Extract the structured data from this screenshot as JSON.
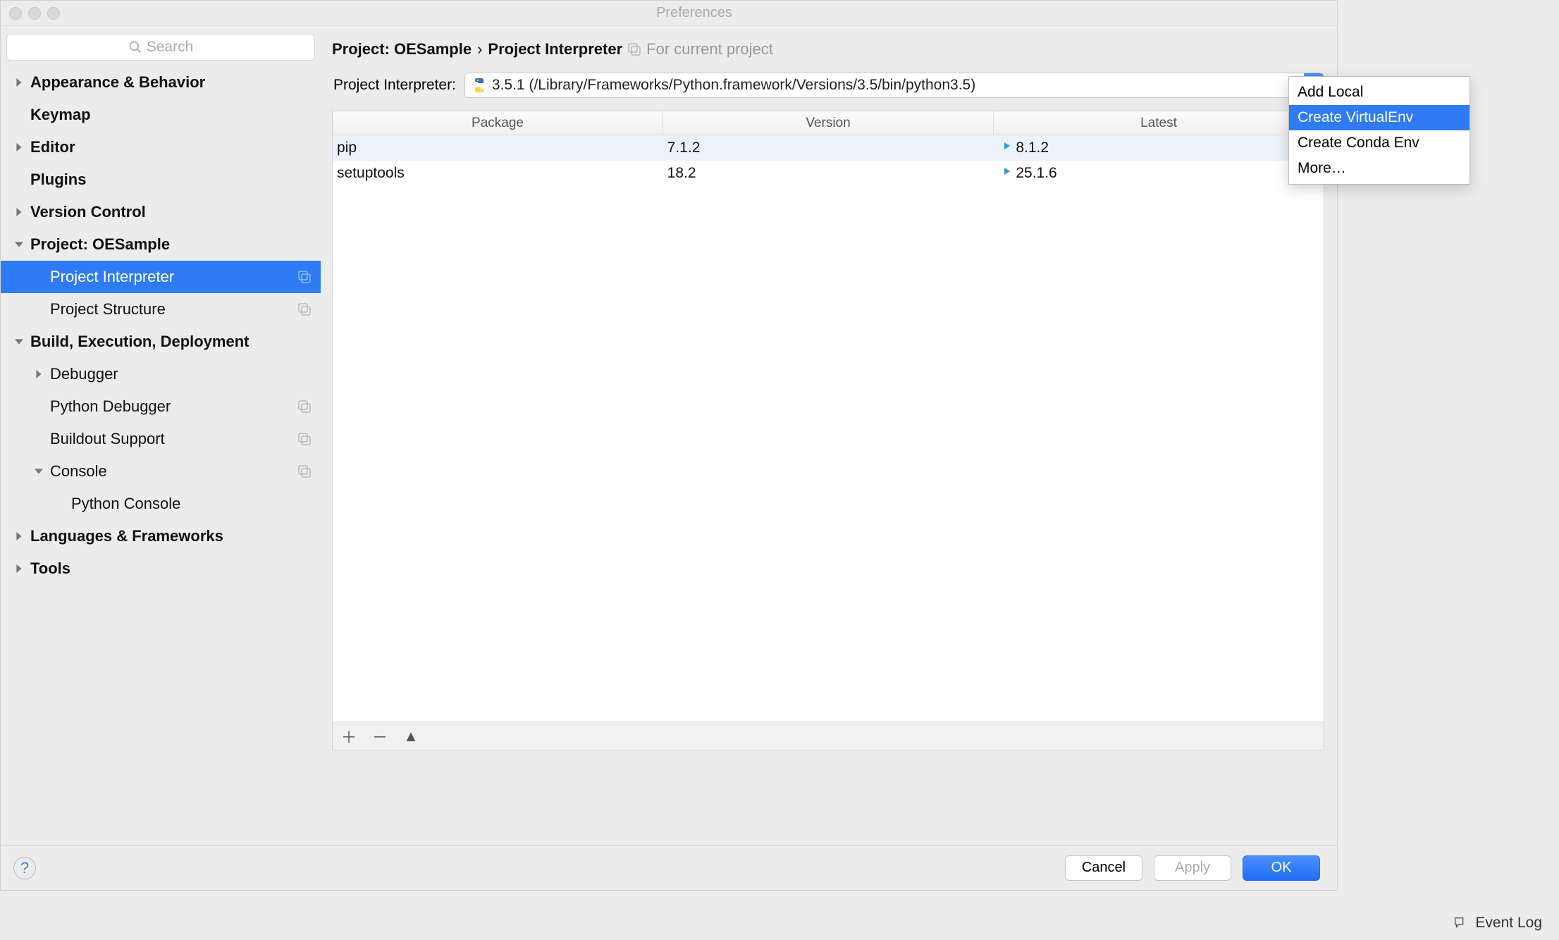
{
  "window": {
    "title": "Preferences"
  },
  "sidebar": {
    "search_placeholder": "Search",
    "items": [
      {
        "label": "Appearance & Behavior",
        "bold": true,
        "arrow": "right",
        "indent": 0
      },
      {
        "label": "Keymap",
        "bold": true,
        "arrow": "none",
        "indent": 0
      },
      {
        "label": "Editor",
        "bold": true,
        "arrow": "right",
        "indent": 0
      },
      {
        "label": "Plugins",
        "bold": true,
        "arrow": "none",
        "indent": 0
      },
      {
        "label": "Version Control",
        "bold": true,
        "arrow": "right",
        "indent": 0
      },
      {
        "label": "Project: OESample",
        "bold": true,
        "arrow": "down",
        "indent": 0
      },
      {
        "label": "Project Interpreter",
        "bold": false,
        "arrow": "none",
        "indent": 1,
        "badge": true,
        "selected": true
      },
      {
        "label": "Project Structure",
        "bold": false,
        "arrow": "none",
        "indent": 1,
        "badge": true
      },
      {
        "label": "Build, Execution, Deployment",
        "bold": true,
        "arrow": "down",
        "indent": 0
      },
      {
        "label": "Debugger",
        "bold": false,
        "arrow": "right",
        "indent": 1
      },
      {
        "label": "Python Debugger",
        "bold": false,
        "arrow": "none",
        "indent": 1,
        "badge": true
      },
      {
        "label": "Buildout Support",
        "bold": false,
        "arrow": "none",
        "indent": 1,
        "badge": true
      },
      {
        "label": "Console",
        "bold": false,
        "arrow": "down",
        "indent": 1,
        "badge": true
      },
      {
        "label": "Python Console",
        "bold": false,
        "arrow": "none",
        "indent": 2
      },
      {
        "label": "Languages & Frameworks",
        "bold": true,
        "arrow": "right",
        "indent": 0
      },
      {
        "label": "Tools",
        "bold": true,
        "arrow": "right",
        "indent": 0
      }
    ]
  },
  "breadcrumb": {
    "project_label": "Project: OESample",
    "separator": "›",
    "page": "Project Interpreter",
    "hint": "For current project"
  },
  "interpreter": {
    "field_label": "Project Interpreter:",
    "value": "3.5.1 (/Library/Frameworks/Python.framework/Versions/3.5/bin/python3.5)"
  },
  "packages": {
    "columns": [
      "Package",
      "Version",
      "Latest"
    ],
    "rows": [
      {
        "name": "pip",
        "version": "7.1.2",
        "latest": "8.1.2",
        "upgradable": true,
        "selected": true
      },
      {
        "name": "setuptools",
        "version": "18.2",
        "latest": "25.1.6",
        "upgradable": true
      }
    ],
    "toolbar_icons": [
      "plus",
      "minus",
      "up"
    ]
  },
  "footer": {
    "cancel": "Cancel",
    "apply": "Apply",
    "ok": "OK",
    "help": "?"
  },
  "popup": {
    "items": [
      {
        "label": "Add Local"
      },
      {
        "label": "Create VirtualEnv",
        "selected": true
      },
      {
        "label": "Create Conda Env"
      },
      {
        "label": "More…"
      }
    ]
  },
  "statusbar": {
    "event_log": "Event Log"
  }
}
